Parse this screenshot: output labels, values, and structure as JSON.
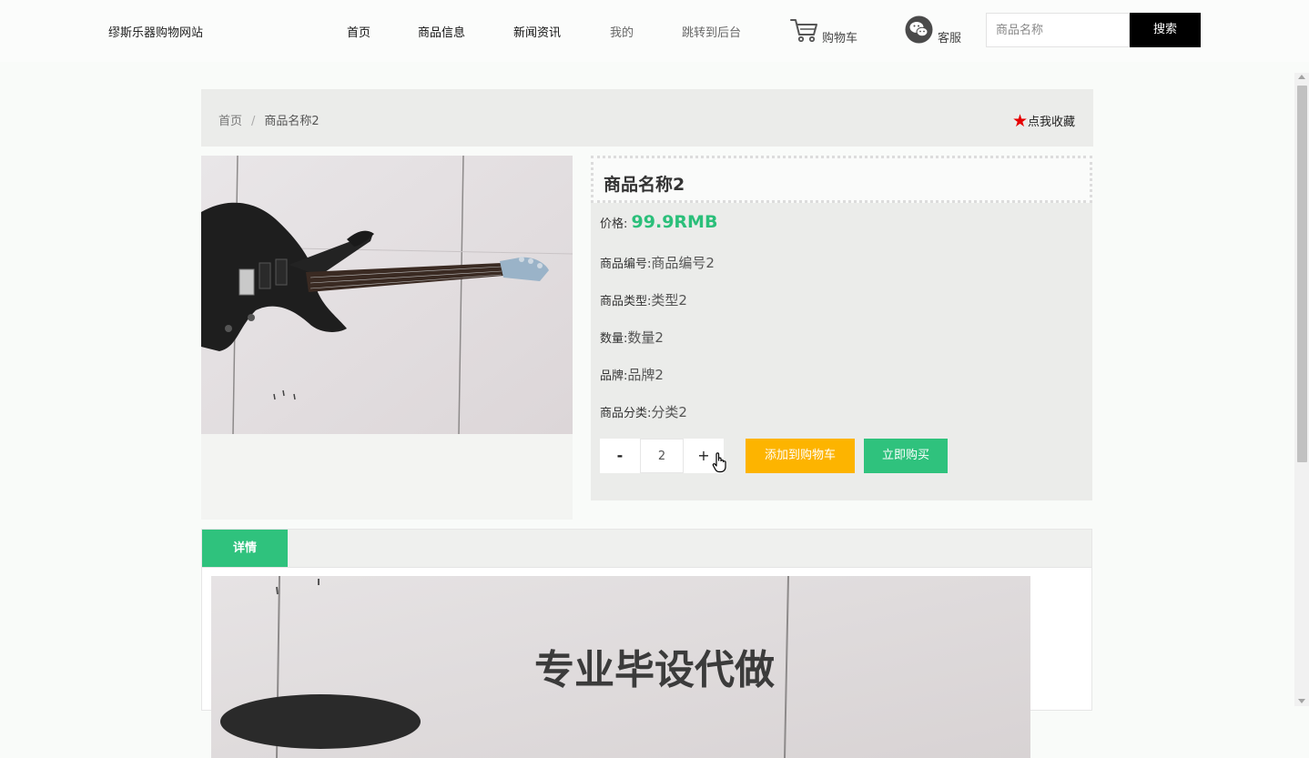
{
  "site": {
    "title": "缪斯乐器购物网站"
  },
  "nav": {
    "items": [
      {
        "label": "首页"
      },
      {
        "label": "商品信息"
      },
      {
        "label": "新闻资讯"
      },
      {
        "label": "我的"
      },
      {
        "label": "跳转到后台"
      }
    ],
    "cart_label": "购物车",
    "service_label": "客服"
  },
  "search": {
    "placeholder": "商品名称",
    "button_label": "搜索"
  },
  "breadcrumb": {
    "home": "首页",
    "separator": "/",
    "current": "商品名称2"
  },
  "favorite": {
    "label": "点我收藏",
    "icon": "star-icon",
    "color": "#e60000"
  },
  "product": {
    "name": "商品名称2",
    "price_label": "价格:",
    "price": "99.9RMB",
    "fields": [
      {
        "label": "商品编号:",
        "value": "商品编号2"
      },
      {
        "label": "商品类型:",
        "value": "类型2"
      },
      {
        "label": "数量:",
        "value": "数量2"
      },
      {
        "label": "品牌:",
        "value": "品牌2"
      },
      {
        "label": "商品分类:",
        "value": "分类2"
      }
    ]
  },
  "purchase": {
    "minus": "-",
    "plus": "+",
    "quantity": "2",
    "add_to_cart": "添加到购物车",
    "buy_now": "立即购买"
  },
  "details": {
    "tab_label": "详情",
    "watermark": "专业毕设代做"
  },
  "colors": {
    "accent_green": "#2fc27d",
    "price_green": "#2bbf7a",
    "cart_orange": "#fdb400",
    "search_button": "#000000"
  }
}
